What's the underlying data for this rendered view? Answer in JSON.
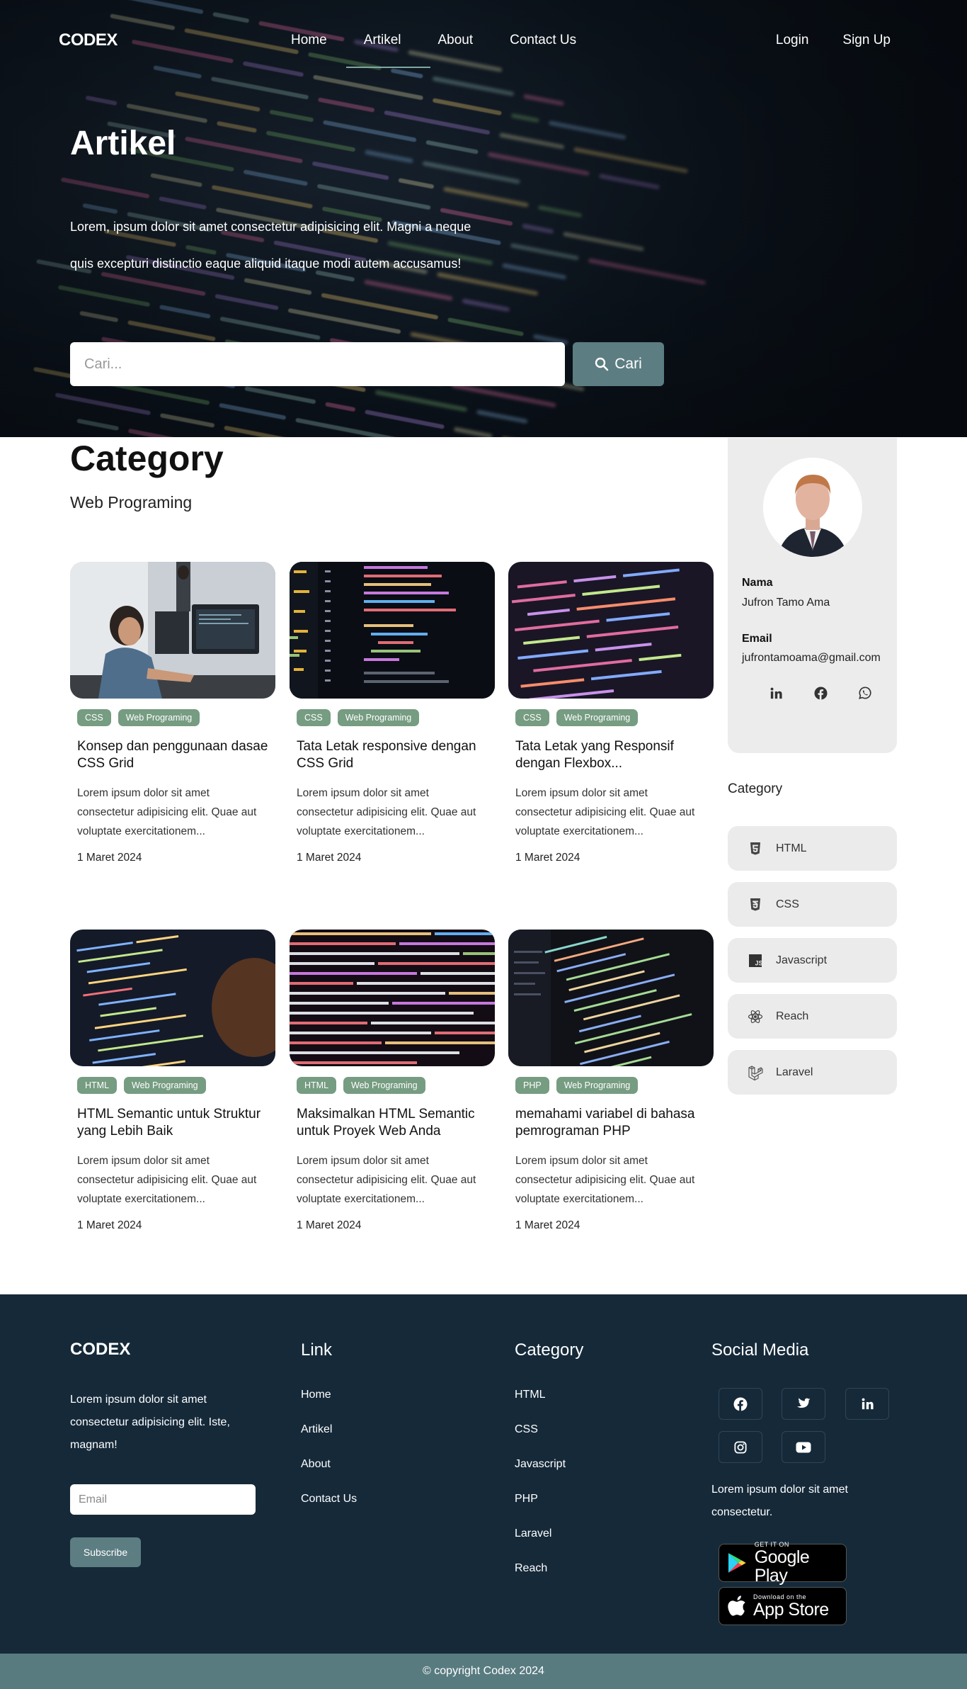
{
  "nav": {
    "brand": "CODEX",
    "links": [
      "Home",
      "Artikel",
      "About",
      "Contact Us"
    ],
    "active": "Artikel",
    "login": "Login",
    "signup": "Sign Up"
  },
  "hero": {
    "title": "Artikel",
    "description": "Lorem, ipsum dolor sit amet consectetur adipisicing elit. Magni a neque quis excepturi distinctio eaque aliquid itaque modi autem accusamus!",
    "search_placeholder": "Cari...",
    "search_button": "Cari"
  },
  "category": {
    "title": "Category",
    "subtitle": "Web Programing"
  },
  "articles": [
    {
      "tags": [
        "CSS",
        "Web Programing"
      ],
      "title": "Konsep dan penggunaan dasae CSS Grid",
      "excerpt": "Lorem ipsum dolor sit amet consectetur adipisicing elit. Quae aut voluptate exercitationem...",
      "date": "1 Maret 2024"
    },
    {
      "tags": [
        "CSS",
        "Web Programing"
      ],
      "title": "Tata Letak responsive dengan CSS Grid",
      "excerpt": "Lorem ipsum dolor sit amet consectetur adipisicing elit. Quae aut voluptate exercitationem...",
      "date": "1 Maret 2024"
    },
    {
      "tags": [
        "CSS",
        "Web Programing"
      ],
      "title": "Tata Letak yang Responsif dengan Flexbox...",
      "excerpt": "Lorem ipsum dolor sit amet consectetur adipisicing elit. Quae aut voluptate exercitationem...",
      "date": "1 Maret 2024"
    },
    {
      "tags": [
        "HTML",
        "Web Programing"
      ],
      "title": "HTML Semantic untuk Struktur yang Lebih Baik",
      "excerpt": "Lorem ipsum dolor sit amet consectetur adipisicing elit. Quae aut voluptate exercitationem...",
      "date": "1 Maret 2024"
    },
    {
      "tags": [
        "HTML",
        "Web Programing"
      ],
      "title": "Maksimalkan HTML Semantic untuk Proyek Web Anda",
      "excerpt": "Lorem ipsum dolor sit amet consectetur adipisicing elit. Quae aut voluptate exercitationem...",
      "date": "1 Maret 2024"
    },
    {
      "tags": [
        "PHP",
        "Web Programing"
      ],
      "title": "memahami variabel di bahasa pemrograman PHP",
      "excerpt": "Lorem ipsum dolor sit amet consectetur adipisicing elit. Quae aut voluptate exercitationem...",
      "date": "1 Maret 2024"
    }
  ],
  "profile": {
    "name_label": "Nama",
    "name": "Jufron Tamo Ama",
    "email_label": "Email",
    "email": "jufrontamoama@gmail.com",
    "social_icons": [
      "linkedin-icon",
      "facebook-icon",
      "whatsapp-icon"
    ]
  },
  "sidebar_categories": {
    "title": "Category",
    "items": [
      {
        "label": "HTML",
        "icon": "html5-icon"
      },
      {
        "label": "CSS",
        "icon": "css3-icon"
      },
      {
        "label": "Javascript",
        "icon": "js-icon"
      },
      {
        "label": "Reach",
        "icon": "react-icon"
      },
      {
        "label": "Laravel",
        "icon": "laravel-icon"
      }
    ]
  },
  "footer": {
    "brand": "CODEX",
    "description": "Lorem ipsum dolor sit amet consectetur adipisicing elit. Iste, magnam!",
    "email_placeholder": "Email",
    "subscribe": "Subscribe",
    "link_title": "Link",
    "links": [
      "Home",
      "Artikel",
      "About",
      "Contact Us"
    ],
    "category_title": "Category",
    "categories": [
      "HTML",
      "CSS",
      "Javascript",
      "PHP",
      "Laravel",
      "Reach"
    ],
    "social_title": "Social Media",
    "social_icons": [
      "facebook-icon",
      "twitter-icon",
      "linkedin-icon",
      "instagram-icon",
      "youtube-icon"
    ],
    "social_desc": "Lorem ipsum dolor sit amet consectetur.",
    "google_play_small": "GET IT ON",
    "google_play_big": "Google Play",
    "app_store_small": "Download on the",
    "app_store_big": "App Store",
    "copyright": "© copyright Codex 2024"
  },
  "colors": {
    "accent": "#5c7d82",
    "tag": "#769c82",
    "footer_bg": "#152939",
    "copyright_bg": "#587b80"
  }
}
